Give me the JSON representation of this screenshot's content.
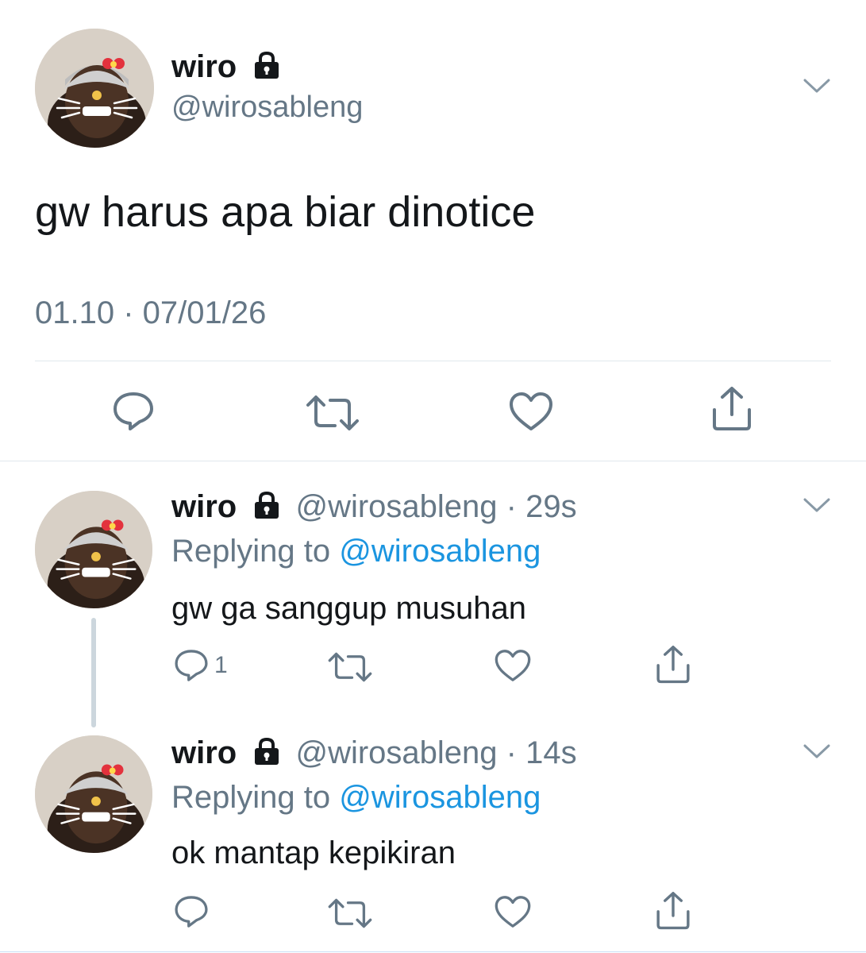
{
  "main_tweet": {
    "display_name": "wiro",
    "handle": "@wirosableng",
    "text": "gw harus apa biar dinotice",
    "timestamp": "01.10 · 07/01/26",
    "icons": [
      "lock-icon",
      "chevron-down-icon",
      "reply-icon",
      "retweet-icon",
      "like-icon",
      "share-icon"
    ]
  },
  "replies": [
    {
      "display_name": "wiro",
      "handle": "@wirosableng",
      "separator": "·",
      "time": "29s",
      "replying_prefix": "Replying to",
      "replying_to": "@wirosableng",
      "text": "gw ga sanggup musuhan",
      "reply_count": "1"
    },
    {
      "display_name": "wiro",
      "handle": "@wirosableng",
      "separator": "·",
      "time": "14s",
      "replying_prefix": "Replying to",
      "replying_to": "@wirosableng",
      "text": "ok mantap kepikiran",
      "reply_count": ""
    }
  ],
  "colors": {
    "text": "#14171a",
    "secondary": "#657786",
    "link": "#1b95e0",
    "divider": "#e1e8ed",
    "thread_line": "#ccd6dd"
  }
}
